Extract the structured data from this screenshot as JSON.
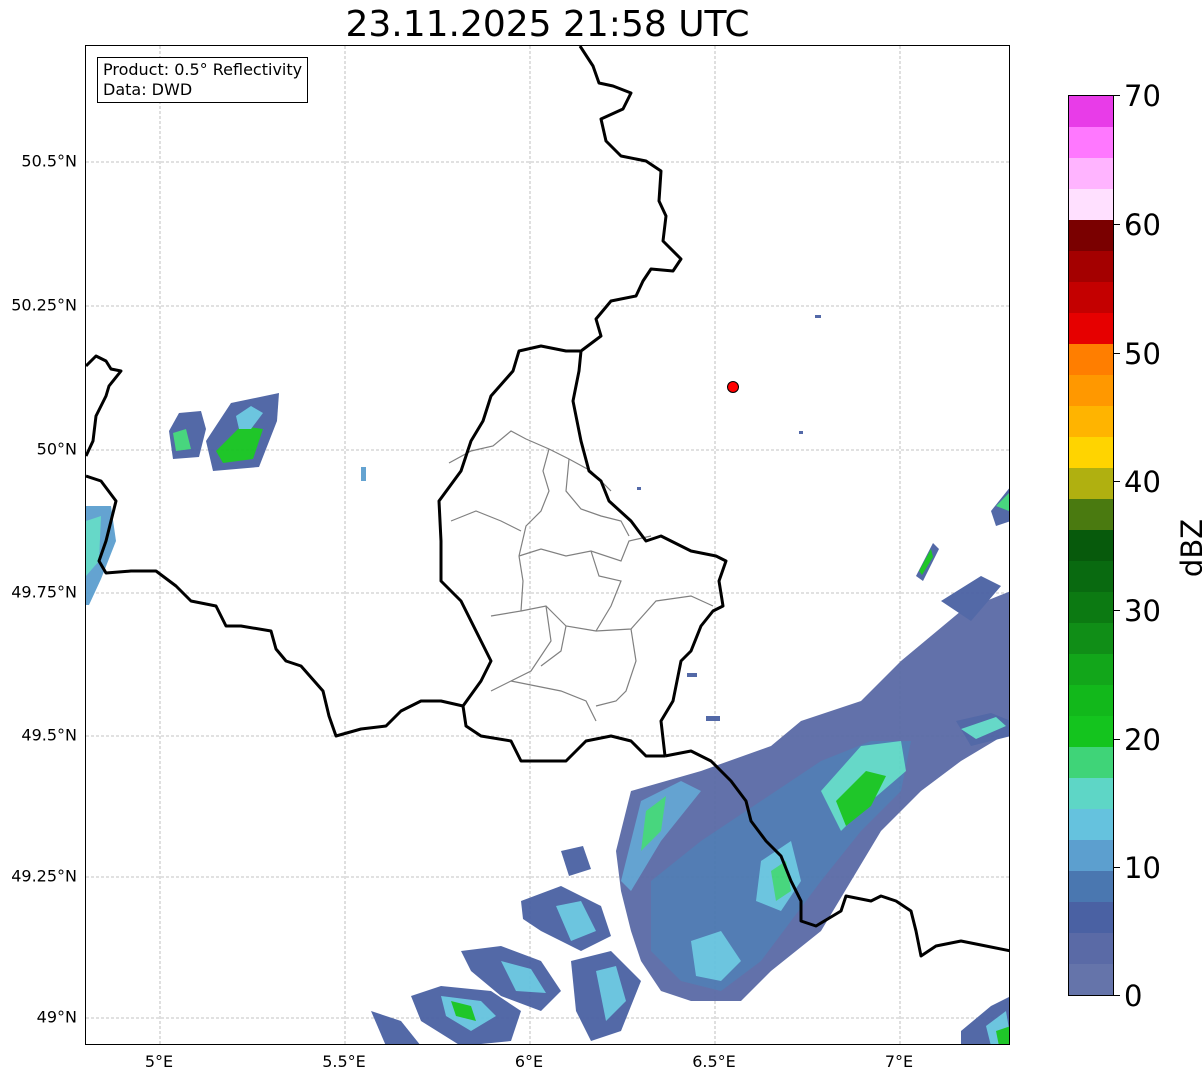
{
  "title": "23.11.2025 21:58 UTC",
  "infobox": {
    "product": "Product: 0.5° Reflectivity",
    "data": "Data: DWD"
  },
  "axes": {
    "lat_labels": [
      "50.5°N",
      "50.25°N",
      "50°N",
      "49.75°N",
      "49.5°N",
      "49.25°N",
      "49°N"
    ],
    "lon_labels": [
      "5°E",
      "5.5°E",
      "6°E",
      "6.5°E",
      "7°E"
    ]
  },
  "colorbar": {
    "unit": "dBZ",
    "tick_labels": [
      "70",
      "60",
      "50",
      "40",
      "30",
      "20",
      "10",
      "0"
    ],
    "min": 0,
    "max": 70,
    "step": 2.5,
    "colors": [
      "#6574aa",
      "#5a6aa6",
      "#4a61a3",
      "#4a77b0",
      "#5c9fcf",
      "#65c2de",
      "#5ed6c6",
      "#3fd478",
      "#14c41e",
      "#12b81b",
      "#12a61a",
      "#108e17",
      "#0c7a12",
      "#096a10",
      "#075a0c",
      "#4a7a10",
      "#b0b010",
      "#ffd400",
      "#ffb400",
      "#ff9800",
      "#ff7e00",
      "#e60000",
      "#c40000",
      "#a40000",
      "#7a0000",
      "#ffe0ff",
      "#ffb4ff",
      "#ff78ff",
      "#e83ce8"
    ]
  },
  "marker": {
    "color": "#ff0000"
  }
}
